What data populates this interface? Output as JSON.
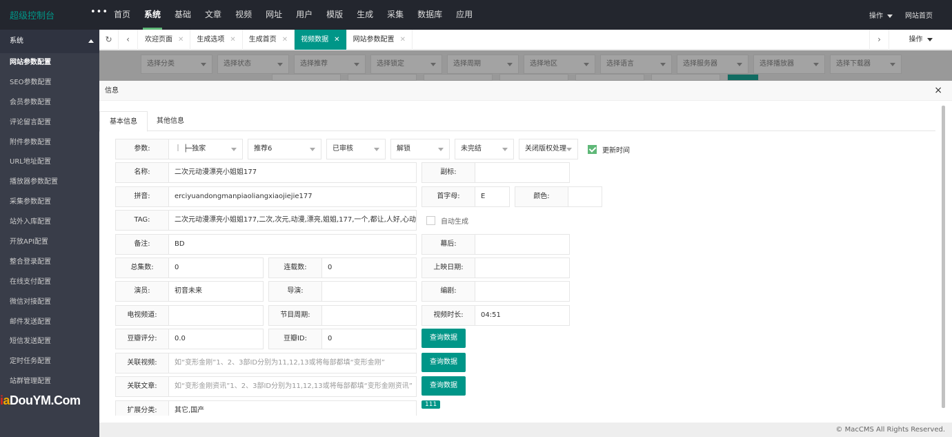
{
  "app": {
    "title": "超级控制台",
    "menu_toggle": "•••"
  },
  "topnav": [
    "首页",
    "系统",
    "基础",
    "文章",
    "视频",
    "网址",
    "用户",
    "模版",
    "生成",
    "采集",
    "数据库",
    "应用"
  ],
  "header_right": {
    "ops": "操作",
    "home": "网站首页"
  },
  "sidebar": {
    "title": "系统",
    "items": [
      "网站参数配置",
      "SEO参数配置",
      "会员参数配置",
      "评论留言配置",
      "附件参数配置",
      "URL地址配置",
      "播放器参数配置",
      "采集参数配置",
      "站外入库配置",
      "开放API配置",
      "整合登录配置",
      "在线支付配置",
      "微信对接配置",
      "邮件发送配置",
      "短信发送配置",
      "定时任务配置",
      "站群管理配置"
    ]
  },
  "watermark": {
    "a": "i",
    "b": "a",
    "c": "DouYM",
    "d": ".Com"
  },
  "tabs": [
    {
      "label": "欢迎页面"
    },
    {
      "label": "生成选项"
    },
    {
      "label": "生成首页"
    },
    {
      "label": "视频数据"
    },
    {
      "label": "网站参数配置"
    }
  ],
  "tab_ops": "操作",
  "filters": [
    "选择分类",
    "选择状态",
    "选择推荐",
    "选择锁定",
    "选择周期",
    "选择地区",
    "选择语言",
    "选择服务器",
    "选择播放器",
    "选择下载器"
  ],
  "modal": {
    "title": "信息",
    "close": "×",
    "tabs": [
      "基本信息",
      "其他信息"
    ],
    "params": {
      "label": "参数:",
      "type": "｜ ├─独家",
      "recommend": "推荐6",
      "status": "已审核",
      "lock": "解锁",
      "finish": "未完结",
      "copyright": "关闭版权处理",
      "update_time": "更新时间"
    },
    "name": {
      "label": "名称:",
      "value": "二次元动漫漂亮小姐姐177"
    },
    "sub": {
      "label": "副标:",
      "value": ""
    },
    "pinyin": {
      "label": "拼音:",
      "value": "erciyuandongmanpiaoliangxiaojiejie177"
    },
    "letter": {
      "label": "首字母:",
      "value": "E"
    },
    "color": {
      "label": "颜色:",
      "value": ""
    },
    "tag": {
      "label": "TAG:",
      "value": "二次元动漫漂亮小姐姐177,二次,次元,动漫,漂亮,姐姐,177,一个,都让,人好,心动"
    },
    "auto_gen": "自动生成",
    "remark": {
      "label": "备注:",
      "value": "BD"
    },
    "behind": {
      "label": "幕后:",
      "value": ""
    },
    "total": {
      "label": "总集数:",
      "value": "0"
    },
    "serial": {
      "label": "连载数:",
      "value": "0"
    },
    "pubdate": {
      "label": "上映日期:",
      "value": ""
    },
    "actor": {
      "label": "演员:",
      "value": "初音未来"
    },
    "director": {
      "label": "导演:",
      "value": ""
    },
    "writer": {
      "label": "编剧:",
      "value": ""
    },
    "tv": {
      "label": "电视频道:",
      "value": ""
    },
    "weekday": {
      "label": "节目周期:",
      "value": ""
    },
    "duration": {
      "label": "视频时长:",
      "value": "04:51"
    },
    "douban_score": {
      "label": "豆瓣评分:",
      "value": "0.0"
    },
    "douban_id": {
      "label": "豆瓣ID:",
      "value": "0"
    },
    "query_btn": "查询数据",
    "rel_vod": {
      "label": "关联视频:",
      "placeholder": "如“变形金刚”1、2、3部ID分别为11,12,13或将每部都填“变形金刚”"
    },
    "rel_art": {
      "label": "关联文章:",
      "placeholder": "如“变形金刚资讯”1、2、3部ID分别为11,12,13或将每部都填“变形金刚资讯”"
    },
    "ext_class": {
      "label": "扩展分类:",
      "value": "其它,国产"
    },
    "badge": "111"
  },
  "footer": "© MacCMS All Rights Reserved."
}
